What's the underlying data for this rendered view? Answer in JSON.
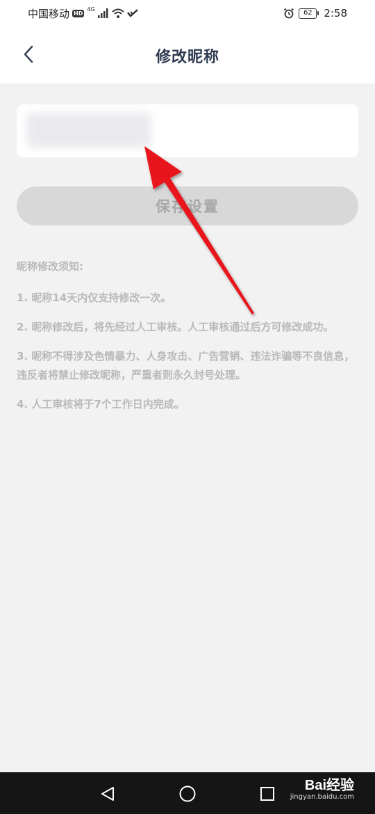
{
  "status_bar": {
    "carrier": "中国移动",
    "hd_badge": "HD",
    "network_type": "4G",
    "battery_level": "62",
    "time": "2:58",
    "icons": [
      "signal-icon",
      "wifi-icon",
      "vowifi-icon",
      "alarm-icon",
      "battery-icon"
    ]
  },
  "header": {
    "title": "修改昵称",
    "back_icon": "chevron-left-icon"
  },
  "form": {
    "nickname_value": "",
    "save_label": "保存设置"
  },
  "notice": {
    "heading": "昵称修改须知:",
    "rules": [
      "1. 昵称14天内仅支持修改一次。",
      "2. 昵称修改后，将先经过人工审核。人工审核通过后方可修改成功。",
      "3. 昵称不得涉及色情暴力、人身攻击、广告营销、违法诈骗等不良信息，违反者将禁止修改昵称，严重者则永久封号处理。",
      "4. 人工审核将于7个工作日内完成。"
    ]
  },
  "annotation": {
    "arrow_color": "#e8141c"
  },
  "system_nav": {
    "icons": [
      "back-triangle-icon",
      "home-circle-icon",
      "recents-square-icon"
    ]
  },
  "watermark": {
    "brand": "Bai经验",
    "url": "jingyan.baidu.com"
  }
}
